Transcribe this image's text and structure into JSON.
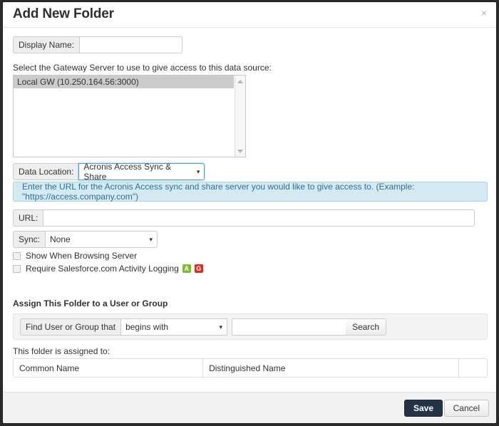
{
  "dialog": {
    "title": "Add New Folder",
    "close_icon": "×"
  },
  "display_name": {
    "label": "Display Name:",
    "value": "",
    "placeholder": ""
  },
  "gateway": {
    "instruction": "Select the Gateway Server to use to give access to this data source:",
    "items": [
      {
        "label": "Local GW (10.250.164.56:3000)",
        "selected": true
      }
    ]
  },
  "data_location": {
    "label": "Data Location:",
    "selected": "Acronis Access Sync & Share",
    "options": [
      "Acronis Access Sync & Share"
    ],
    "caret": "▾"
  },
  "info_banner": {
    "text": "Enter the URL for the Acronis Access sync and share server you would like to give access to. (Example: \"https://access.company.com\")"
  },
  "url": {
    "label": "URL:",
    "value": "",
    "placeholder": ""
  },
  "sync": {
    "label": "Sync:",
    "selected": "None",
    "options": [
      "None"
    ],
    "caret": "▾"
  },
  "checkboxes": [
    {
      "label": "Show When Browsing Server",
      "checked": false,
      "badges": []
    },
    {
      "label": "Require Salesforce.com Activity Logging",
      "checked": false,
      "badges": [
        {
          "text": "A",
          "color": "#7bbf2f"
        },
        {
          "text": "G",
          "color": "#e02b20"
        }
      ]
    }
  ],
  "assign": {
    "heading": "Assign This Folder to a User or Group",
    "find_label": "Find User or Group that",
    "match_selected": "begins with",
    "match_options": [
      "begins with"
    ],
    "caret": "▾",
    "query": "",
    "query_placeholder": "",
    "search_button": "Search"
  },
  "assigned": {
    "heading": "This folder is assigned to:",
    "columns": [
      "Common Name",
      "Distinguished Name",
      ""
    ],
    "rows": []
  },
  "footer": {
    "save_label": "Save",
    "cancel_label": "Cancel"
  },
  "colors": {
    "save_button": "#243447",
    "info_banner_bg": "#d4eaf2",
    "info_banner_border": "#a8d4e0",
    "focus_ring": "#4f9ad6",
    "badge_green": "#7bbf2f",
    "badge_red": "#e02b20"
  }
}
